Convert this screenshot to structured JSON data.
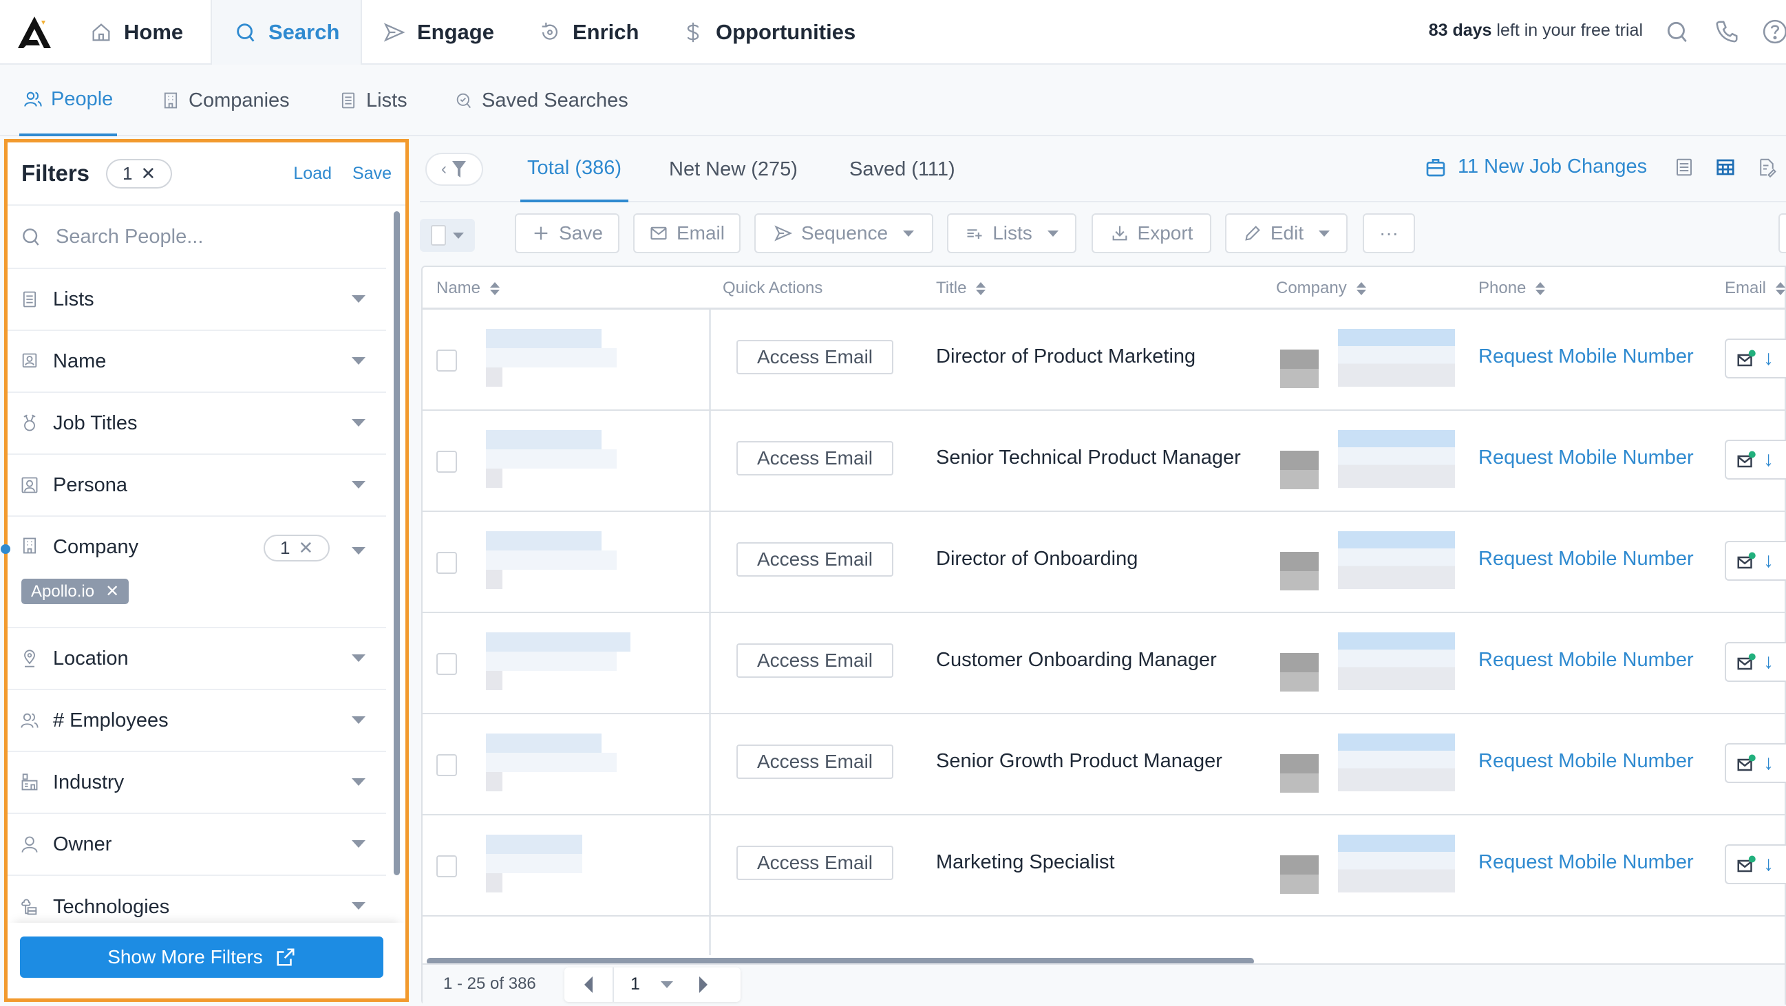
{
  "topnav": {
    "items": [
      {
        "label": "Home",
        "icon": "home-icon"
      },
      {
        "label": "Search",
        "icon": "search-icon",
        "active": true
      },
      {
        "label": "Engage",
        "icon": "send-icon"
      },
      {
        "label": "Enrich",
        "icon": "refresh-icon"
      },
      {
        "label": "Opportunities",
        "icon": "dollar-icon"
      }
    ],
    "trial_bold": "83 days",
    "trial_rest": " left in your free trial"
  },
  "subnav": {
    "tabs": [
      {
        "label": "People",
        "active": true
      },
      {
        "label": "Companies"
      },
      {
        "label": "Lists"
      },
      {
        "label": "Saved Searches"
      }
    ]
  },
  "filters": {
    "title": "Filters",
    "count": "1",
    "load": "Load",
    "save": "Save",
    "search_placeholder": "Search People...",
    "items": [
      {
        "label": "Lists"
      },
      {
        "label": "Name"
      },
      {
        "label": "Job Titles"
      },
      {
        "label": "Persona"
      },
      {
        "label": "Company",
        "count": "1",
        "tag": "Apollo.io"
      },
      {
        "label": "Location"
      },
      {
        "label": "# Employees"
      },
      {
        "label": "Industry"
      },
      {
        "label": "Owner"
      },
      {
        "label": "Technologies"
      }
    ],
    "show_more": "Show More Filters"
  },
  "views": {
    "tabs": [
      {
        "label": "Total (386)",
        "active": true
      },
      {
        "label": "Net New (275)"
      },
      {
        "label": "Saved (111)"
      }
    ],
    "job_changes": "11 New Job Changes"
  },
  "toolbar": {
    "save": "Save",
    "email": "Email",
    "sequence": "Sequence",
    "lists": "Lists",
    "export": "Export",
    "edit": "Edit",
    "more": "···"
  },
  "table": {
    "columns": [
      "Name",
      "Quick Actions",
      "Title",
      "Company",
      "Phone",
      "Email"
    ],
    "rows": [
      {
        "action": "Access Email",
        "title": "Director of Product Marketing",
        "phone": "Request Mobile Number"
      },
      {
        "action": "Access Email",
        "title": "Senior Technical Product Manager",
        "phone": "Request Mobile Number"
      },
      {
        "action": "Access Email",
        "title": "Director of Onboarding",
        "phone": "Request Mobile Number"
      },
      {
        "action": "Access Email",
        "title": "Customer Onboarding Manager",
        "phone": "Request Mobile Number"
      },
      {
        "action": "Access Email",
        "title": "Senior Growth Product Manager",
        "phone": "Request Mobile Number"
      },
      {
        "action": "Access Email",
        "title": "Marketing Specialist",
        "phone": "Request Mobile Number"
      }
    ]
  },
  "pagination": {
    "range": "1 - 25 of 386",
    "page": "1"
  },
  "colors": {
    "accent": "#2f8ad0",
    "primary_button": "#1d8ce3",
    "highlight": "#f29a2e"
  }
}
